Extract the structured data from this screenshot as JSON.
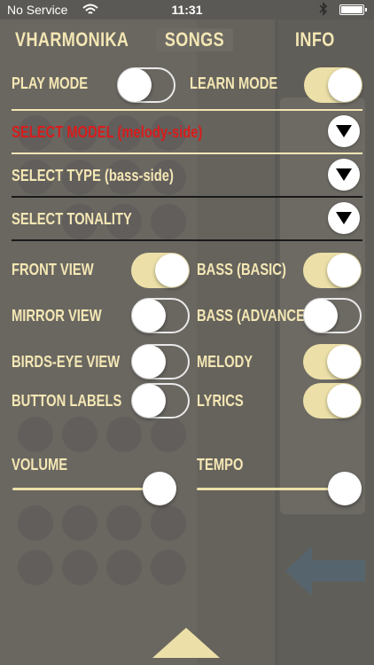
{
  "status_bar": {
    "carrier": "No Service",
    "time": "11:31"
  },
  "nav": {
    "tabs": [
      {
        "label": "VHARMONIKA",
        "selected": false
      },
      {
        "label": "SONGS",
        "selected": true
      },
      {
        "label": "INFO",
        "selected": false
      }
    ]
  },
  "modes": {
    "play_mode": {
      "label": "PLAY MODE",
      "on": false
    },
    "learn_mode": {
      "label": "LEARN MODE",
      "on": true
    }
  },
  "selectors": {
    "model": {
      "label": "SELECT MODEL (melody-side)"
    },
    "type": {
      "label": "SELECT TYPE (bass-side)"
    },
    "tonality": {
      "label": "SELECT TONALITY"
    }
  },
  "options": {
    "front_view": {
      "label": "FRONT VIEW",
      "on": true
    },
    "mirror_view": {
      "label": "MIRROR VIEW",
      "on": false
    },
    "birds_eye_view": {
      "label": "BIRDS-EYE VIEW",
      "on": false
    },
    "button_labels": {
      "label": "BUTTON LABELS",
      "on": false
    },
    "bass_basic": {
      "label": "BASS (BASIC)",
      "on": true
    },
    "bass_advanced": {
      "label": "BASS (ADVANCED)",
      "on": false
    },
    "melody": {
      "label": "MELODY",
      "on": true
    },
    "lyrics": {
      "label": "LYRICS",
      "on": true
    }
  },
  "sliders": {
    "volume": {
      "label": "VOLUME",
      "value": 1.0
    },
    "tempo": {
      "label": "TEMPO",
      "value": 1.0
    }
  },
  "colors": {
    "accent": "#f4e7b4",
    "toggle_on": "#ece0a8",
    "warning_red": "#d81c1c",
    "background": "#5e5c58"
  },
  "icons": {
    "wifi": "wifi-icon",
    "bluetooth": "bluetooth-icon",
    "battery": "battery-icon",
    "dropdown": "chevron-down-icon",
    "collapse": "triangle-up-icon"
  }
}
